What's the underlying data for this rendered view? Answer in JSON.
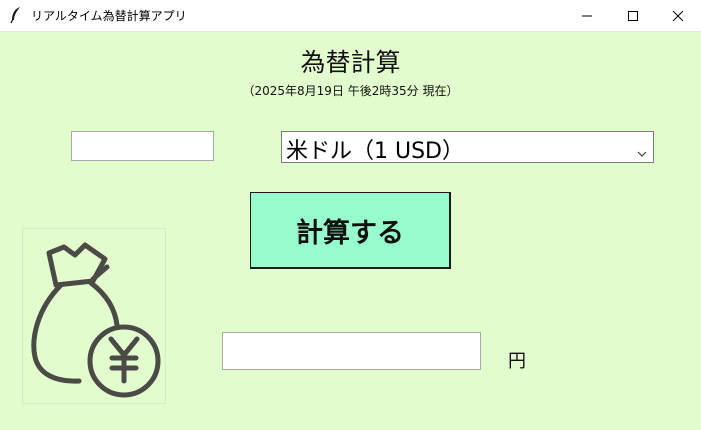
{
  "window": {
    "title": "リアルタイム為替計算アプリ",
    "app_icon": "feather-icon",
    "controls": [
      "minimize-icon",
      "maximize-icon",
      "close-icon"
    ]
  },
  "main": {
    "heading": "為替計算",
    "timestamp": "（2025年8月19日 午後2時35分 現在）",
    "amount_input": {
      "value": "",
      "placeholder": ""
    },
    "currency_select": {
      "selected": "米ドル（1 USD）",
      "icon": "chevron-down-icon"
    },
    "calc_button_label": "計算する",
    "result": {
      "value": "",
      "unit": "円"
    },
    "illustration_icon": "money-bag-yen-icon"
  },
  "colors": {
    "background": "#e2fccd",
    "button": "#98fdce",
    "titlebar": "#ffffff"
  }
}
